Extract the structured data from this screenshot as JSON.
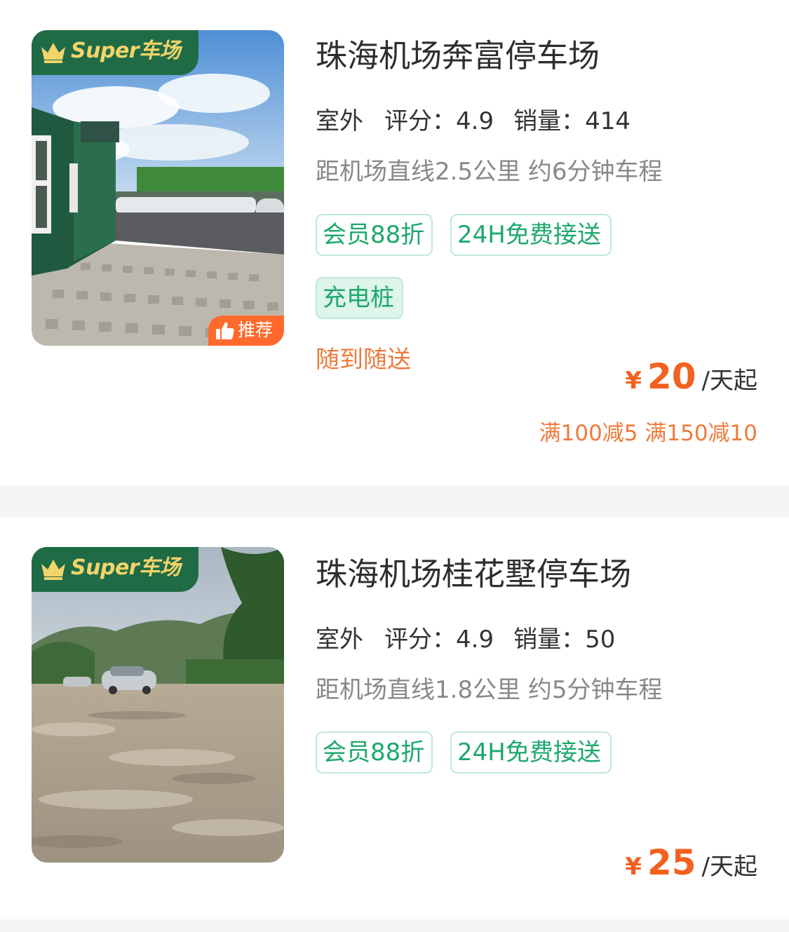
{
  "listings": [
    {
      "super_badge": "Super车场",
      "recommend_badge": "推荐",
      "name": "珠海机场奔富停车场",
      "type": "室外",
      "rating_label": "评分：",
      "rating": "4.9",
      "sales_label": "销量：",
      "sales": "414",
      "distance": "距机场直线2.5公里 约6分钟车程",
      "tags": [
        "会员88折",
        "24H免费接送",
        "充电桩"
      ],
      "service_note": "随到随送",
      "price_symbol": "¥",
      "price": "20",
      "price_unit": "/天起",
      "discount": "满100减5 满150减10"
    },
    {
      "super_badge": "Super车场",
      "name": "珠海机场桂花墅停车场",
      "type": "室外",
      "rating_label": "评分：",
      "rating": "4.9",
      "sales_label": "销量：",
      "sales": "50",
      "distance": "距机场直线1.8公里 约5分钟车程",
      "tags": [
        "会员88折",
        "24H免费接送"
      ],
      "price_symbol": "¥",
      "price": "25",
      "price_unit": "/天起"
    }
  ],
  "colors": {
    "brand_green": "#1f6b46",
    "badge_gold": "#f3d46a",
    "tag_green": "#1ea86b",
    "price_orange": "#f2611f",
    "recommend_orange": "#ff6a2c"
  }
}
